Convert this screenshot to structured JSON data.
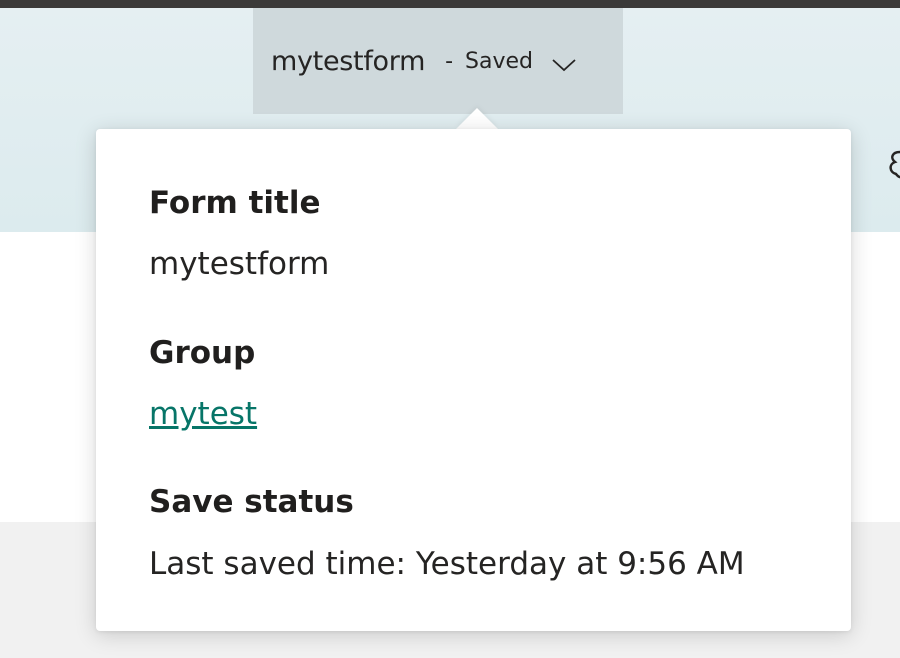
{
  "header": {
    "form_name": "mytestform",
    "separator": "-",
    "save_status": "Saved"
  },
  "popup": {
    "form_title_heading": "Form title",
    "form_title_value": "mytestform",
    "group_heading": "Group",
    "group_link": "mytest",
    "save_status_heading": "Save status",
    "save_status_value": "Last saved time: Yesterday at 9:56 AM"
  },
  "colors": {
    "link": "#077568",
    "header_band": "#e5eff2",
    "dropdown_bg": "#cfd9dc"
  },
  "icons": {
    "chevron": "chevron-down-icon",
    "settings": "gear-icon"
  }
}
